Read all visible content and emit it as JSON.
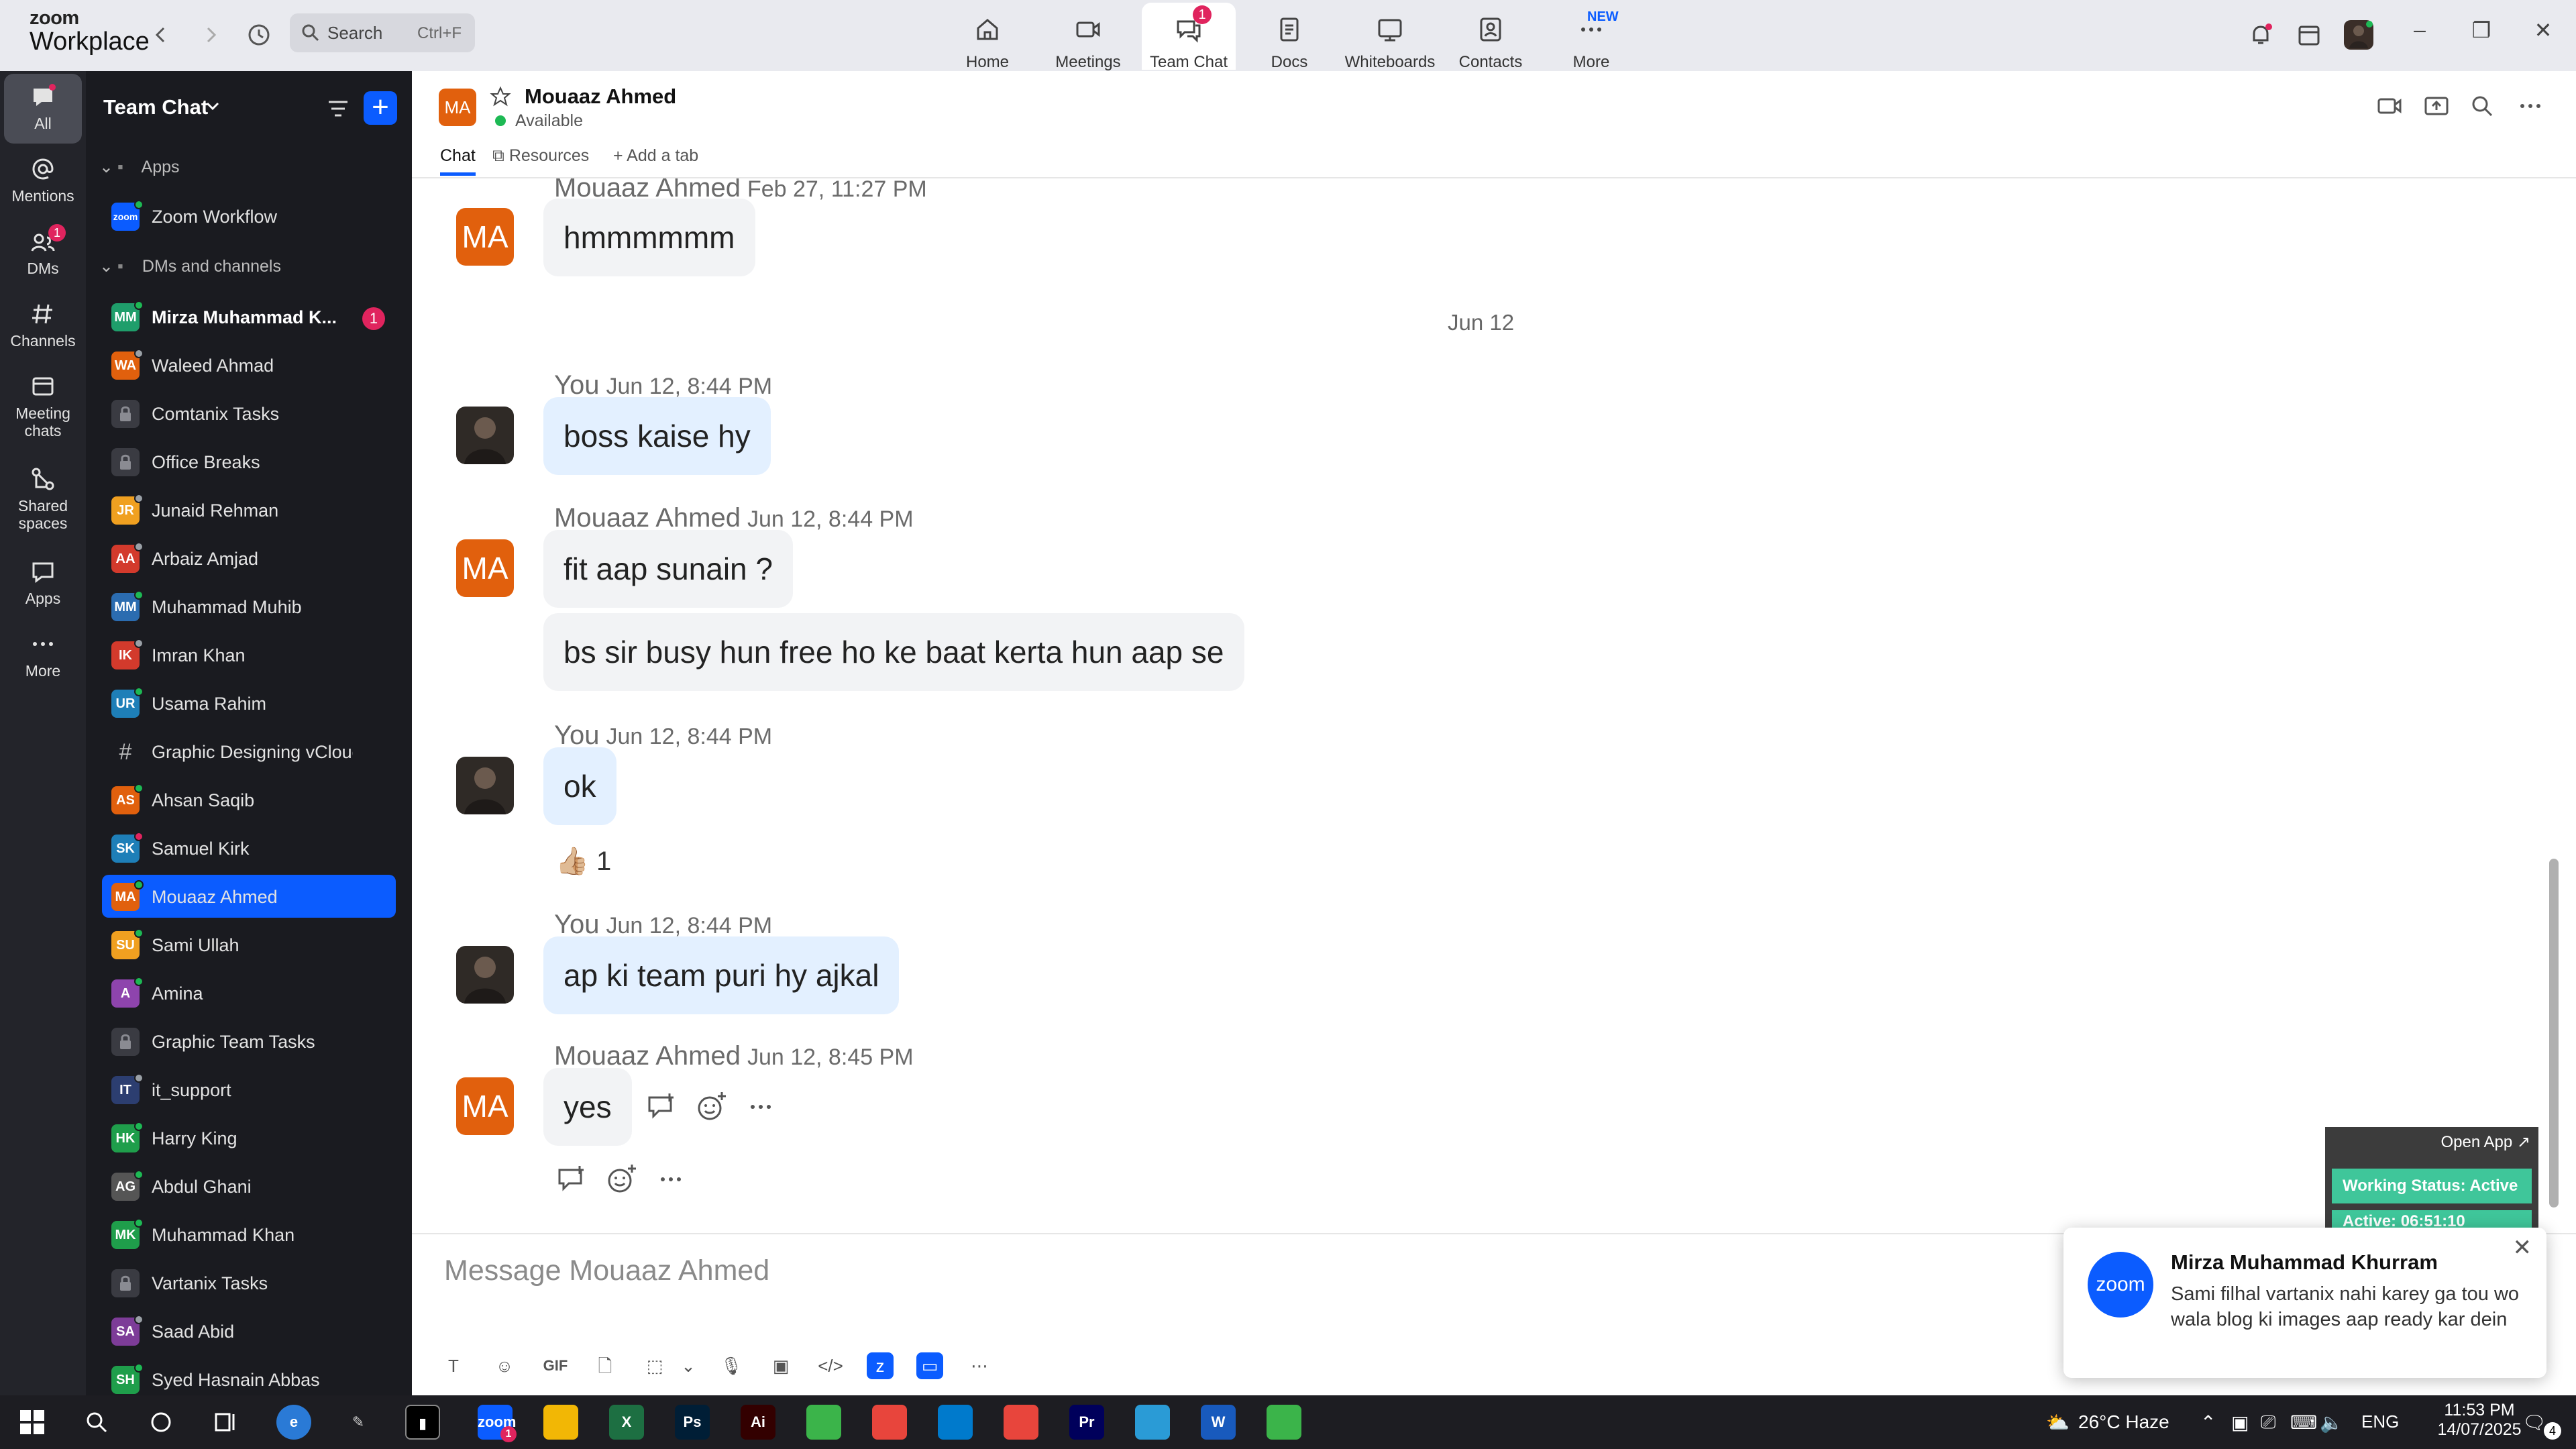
{
  "app": {
    "logo_top": "zoom",
    "logo_bottom": "Workplace"
  },
  "search": {
    "placeholder": "Search",
    "shortcut": "Ctrl+F"
  },
  "nav": [
    {
      "label": "Home"
    },
    {
      "label": "Meetings"
    },
    {
      "label": "Team Chat",
      "badge": "1"
    },
    {
      "label": "Docs"
    },
    {
      "label": "Whiteboards"
    },
    {
      "label": "Contacts"
    },
    {
      "label": "More",
      "badge": "NEW"
    }
  ],
  "rail": [
    {
      "label": "All"
    },
    {
      "label": "Mentions"
    },
    {
      "label": "DMs",
      "badge": "1"
    },
    {
      "label": "Channels"
    },
    {
      "label": "Meeting chats"
    },
    {
      "label": "Shared spaces"
    },
    {
      "label": "Apps"
    },
    {
      "label": "More"
    }
  ],
  "sidebar": {
    "title": "Team Chat",
    "sections": [
      {
        "label": "Apps"
      },
      {
        "label": "DMs and channels"
      }
    ],
    "app_item": {
      "label": "Zoom Workflow",
      "avatar": "zoom"
    },
    "items": [
      {
        "initials": "MM",
        "name": "Mirza Muhammad K...",
        "color": "#1f9e6b",
        "status": "#1db954",
        "unread": "1"
      },
      {
        "initials": "WA",
        "name": "Waleed Ahmad",
        "color": "#e1600d",
        "status": "#9aa0a6"
      },
      {
        "initials": "",
        "name": "Comtanix Tasks",
        "color": "lock"
      },
      {
        "initials": "",
        "name": "Office Breaks",
        "color": "lock"
      },
      {
        "initials": "JR",
        "name": "Junaid Rehman",
        "color": "#f0a020",
        "status": "#9aa0a6"
      },
      {
        "initials": "AA",
        "name": "Arbaiz Amjad",
        "color": "#d33a2c",
        "status": "#9aa0a6"
      },
      {
        "initials": "MM",
        "name": "Muhammad Muhib",
        "color": "#2b6cb0",
        "status": "#1db954"
      },
      {
        "initials": "IK",
        "name": "Imran Khan",
        "color": "#d33a2c",
        "status": "#9aa0a6"
      },
      {
        "initials": "UR",
        "name": "Usama Rahim",
        "color": "#1e7fb8",
        "status": "#1db954"
      },
      {
        "initials": "#",
        "name": "Graphic Designing vCloud",
        "color": "hash"
      },
      {
        "initials": "AS",
        "name": "Ahsan Saqib",
        "color": "#e1600d",
        "status": "#1db954"
      },
      {
        "initials": "SK",
        "name": "Samuel Kirk",
        "color": "#1e7fb8",
        "status": "#e0245e"
      },
      {
        "initials": "MA",
        "name": "Mouaaz Ahmed",
        "color": "#e1600d",
        "status": "#1db954",
        "active": true
      },
      {
        "initials": "SU",
        "name": "Sami Ullah",
        "color": "#f0a020",
        "status": "#1db954"
      },
      {
        "initials": "A",
        "name": "Amina",
        "color": "#8e44ad",
        "status": "#1db954"
      },
      {
        "initials": "",
        "name": "Graphic Team Tasks",
        "color": "lock"
      },
      {
        "initials": "IT",
        "name": "it_support",
        "color": "#2c3e70",
        "status": "#9aa0a6"
      },
      {
        "initials": "HK",
        "name": "Harry King",
        "color": "#1f9e4b",
        "status": "#1db954"
      },
      {
        "initials": "AG",
        "name": "Abdul Ghani",
        "color": "#555555",
        "status": "#1db954"
      },
      {
        "initials": "MK",
        "name": "Muhammad Khan",
        "color": "#1f9e4b",
        "status": "#1db954"
      },
      {
        "initials": "",
        "name": "Vartanix Tasks",
        "color": "lock"
      },
      {
        "initials": "SA",
        "name": "Saad Abid",
        "color": "#7d3c98",
        "status": "#9aa0a6"
      },
      {
        "initials": "SH",
        "name": "Syed Hasnain Abbas",
        "color": "#1f9e4b",
        "status": "#1db954"
      }
    ]
  },
  "header": {
    "avatar": "MA",
    "name": "Mouaaz Ahmed",
    "status": "Available",
    "tabs": [
      {
        "label": "Chat"
      },
      {
        "label": "Resources"
      },
      {
        "label": "+ Add a tab"
      }
    ]
  },
  "messages": {
    "first": {
      "sender": "Mouaaz Ahmed",
      "time": "Feb 27, 11:27 PM",
      "avatar": "MA",
      "text": "hmmmmmm"
    },
    "date_divider": "Jun 12",
    "m1": {
      "sender": "You",
      "time": "Jun 12, 8:44 PM",
      "text": "boss kaise hy"
    },
    "m2": {
      "sender": "Mouaaz Ahmed",
      "time": "Jun 12, 8:44 PM",
      "avatar": "MA",
      "text": "fit aap sunain ?",
      "text2": "bs sir busy hun free ho ke baat kerta hun aap se"
    },
    "m3": {
      "sender": "You",
      "time": "Jun 12, 8:44 PM",
      "text": "ok",
      "reaction_emoji": "👍🏼",
      "reaction_count": "1"
    },
    "m4": {
      "sender": "You",
      "time": "Jun 12, 8:44 PM",
      "text": "ap ki team puri hy ajkal"
    },
    "m5": {
      "sender": "Mouaaz Ahmed",
      "time": "Jun 12, 8:45 PM",
      "avatar": "MA",
      "text": "yes"
    }
  },
  "composer": {
    "placeholder": "Message Mouaaz Ahmed",
    "gif_label": "GIF"
  },
  "widget": {
    "open_app": "Open App ↗",
    "working_status": "Working Status: Active",
    "active_time": "Active: 06:51:10"
  },
  "toast": {
    "app": "zoom",
    "sender": "Mirza Muhammad Khurram",
    "text": "Sami filhal vartanix nahi karey ga tou wo wala blog ki images aap ready kar dein"
  },
  "taskbar": {
    "weather": "26°C Haze",
    "lang": "ENG",
    "time": "11:53 PM",
    "date": "14/07/2025",
    "notif_count": "4",
    "apps": [
      {
        "name": "zoom-taskbar-icon",
        "label": "zoom",
        "color": "#0b5cff",
        "badge": "1"
      },
      {
        "name": "file-explorer-icon",
        "label": "",
        "color": "#f2b705"
      },
      {
        "name": "excel-icon",
        "label": "X",
        "color": "#1d6f42"
      },
      {
        "name": "photoshop-icon",
        "label": "Ps",
        "color": "#001e36"
      },
      {
        "name": "illustrator-icon",
        "label": "Ai",
        "color": "#330000"
      },
      {
        "name": "green-app-icon",
        "label": "",
        "color": "#3bb44a"
      },
      {
        "name": "chrome-icon",
        "label": "",
        "color": "#e8453c"
      },
      {
        "name": "vscode-icon",
        "label": "",
        "color": "#007acc"
      },
      {
        "name": "chrome-profile-icon",
        "label": "",
        "color": "#e8453c"
      },
      {
        "name": "premiere-icon",
        "label": "Pr",
        "color": "#00005b"
      },
      {
        "name": "diamond-app-icon",
        "label": "",
        "color": "#2a9bd6"
      },
      {
        "name": "word-icon",
        "label": "W",
        "color": "#185abd"
      },
      {
        "name": "green-app-2-icon",
        "label": "",
        "color": "#3bb44a"
      }
    ]
  }
}
